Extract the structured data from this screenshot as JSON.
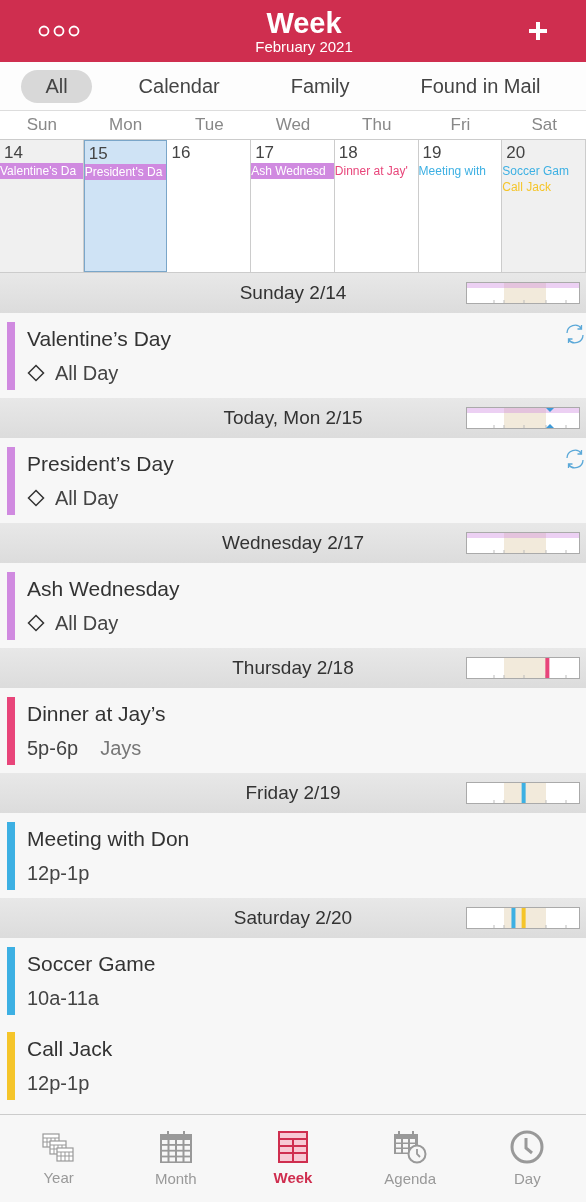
{
  "header": {
    "title": "Week",
    "subtitle": "February 2021"
  },
  "filters": [
    {
      "label": "All",
      "selected": true
    },
    {
      "label": "Calendar",
      "selected": false
    },
    {
      "label": "Family",
      "selected": false
    },
    {
      "label": "Found in Mail",
      "selected": false
    }
  ],
  "weekdays": [
    "Sun",
    "Mon",
    "Tue",
    "Wed",
    "Thu",
    "Fri",
    "Sat"
  ],
  "days": [
    {
      "number": "14",
      "selected": false,
      "shaded": true,
      "events": [
        {
          "title": "Valentine's Da",
          "kind": "allday",
          "color": "#d08ae0"
        }
      ]
    },
    {
      "number": "15",
      "selected": true,
      "shaded": false,
      "events": [
        {
          "title": "President's Da",
          "kind": "allday",
          "color": "#d08ae0"
        }
      ]
    },
    {
      "number": "16",
      "selected": false,
      "shaded": false
    },
    {
      "number": "17",
      "selected": false,
      "shaded": false,
      "events": [
        {
          "title": "Ash Wednesd",
          "kind": "allday",
          "color": "#d08ae0"
        }
      ]
    },
    {
      "number": "18",
      "selected": false,
      "shaded": false,
      "events": [
        {
          "title": "Dinner at Jay'",
          "kind": "timed",
          "color": "#e8457a"
        }
      ]
    },
    {
      "number": "19",
      "selected": false,
      "shaded": false,
      "events": [
        {
          "title": "Meeting with",
          "kind": "timed",
          "color": "#3db0e3"
        }
      ]
    },
    {
      "number": "20",
      "selected": false,
      "shaded": true,
      "events": [
        {
          "title": "Soccer Gam",
          "kind": "timed",
          "color": "#3db0e3"
        },
        {
          "title": "Call Jack",
          "kind": "timed",
          "color": "#f5c52a"
        }
      ]
    }
  ],
  "sections": [
    {
      "heading": "Sunday 2/14",
      "timeline": {
        "all_day": true,
        "now": false
      },
      "events": [
        {
          "title": "Valentine’s Day",
          "kind": "allday",
          "time": "All Day",
          "color": "#d08ae0",
          "recurring": true
        }
      ]
    },
    {
      "heading": "Today, Mon 2/15",
      "timeline": {
        "all_day": true,
        "now": true
      },
      "events": [
        {
          "title": "President’s Day",
          "kind": "allday",
          "time": "All Day",
          "color": "#d08ae0",
          "recurring": true
        }
      ]
    },
    {
      "heading": "Wednesday 2/17",
      "timeline": {
        "all_day": true,
        "now": false
      },
      "events": [
        {
          "title": "Ash Wednesday",
          "kind": "allday",
          "time": "All Day",
          "color": "#d08ae0",
          "recurring": false
        }
      ]
    },
    {
      "heading": "Thursday 2/18",
      "timeline": {
        "all_day": false,
        "now": false,
        "marks": [
          {
            "color": "#e8457a",
            "level": 0.72
          }
        ]
      },
      "events": [
        {
          "title": "Dinner at Jay’s",
          "kind": "timed",
          "time": "5p-6p",
          "location": "Jays",
          "color": "#e8457a",
          "recurring": false
        }
      ]
    },
    {
      "heading": "Friday 2/19",
      "timeline": {
        "all_day": false,
        "now": false,
        "marks": [
          {
            "color": "#3db0e3",
            "level": 0.51
          }
        ]
      },
      "events": [
        {
          "title": "Meeting with Don",
          "kind": "timed",
          "time": "12p-1p",
          "color": "#3db0e3",
          "recurring": false
        }
      ]
    },
    {
      "heading": "Saturday 2/20",
      "timeline": {
        "all_day": false,
        "now": false,
        "marks": [
          {
            "color": "#3db0e3",
            "level": 0.42
          },
          {
            "color": "#f5c52a",
            "level": 0.51
          }
        ]
      },
      "events": [
        {
          "title": "Soccer Game",
          "kind": "timed",
          "time": "10a-11a",
          "color": "#3db0e3",
          "recurring": false
        },
        {
          "title": "Call Jack",
          "kind": "timed",
          "time": "12p-1p",
          "color": "#f5c52a",
          "recurring": false
        }
      ]
    }
  ],
  "tabs": [
    {
      "label": "Year",
      "kind": "year",
      "selected": false
    },
    {
      "label": "Month",
      "kind": "month",
      "selected": false
    },
    {
      "label": "Week",
      "kind": "week",
      "selected": true
    },
    {
      "label": "Agenda",
      "kind": "agenda",
      "selected": false
    },
    {
      "label": "Day",
      "kind": "day",
      "selected": false
    }
  ]
}
